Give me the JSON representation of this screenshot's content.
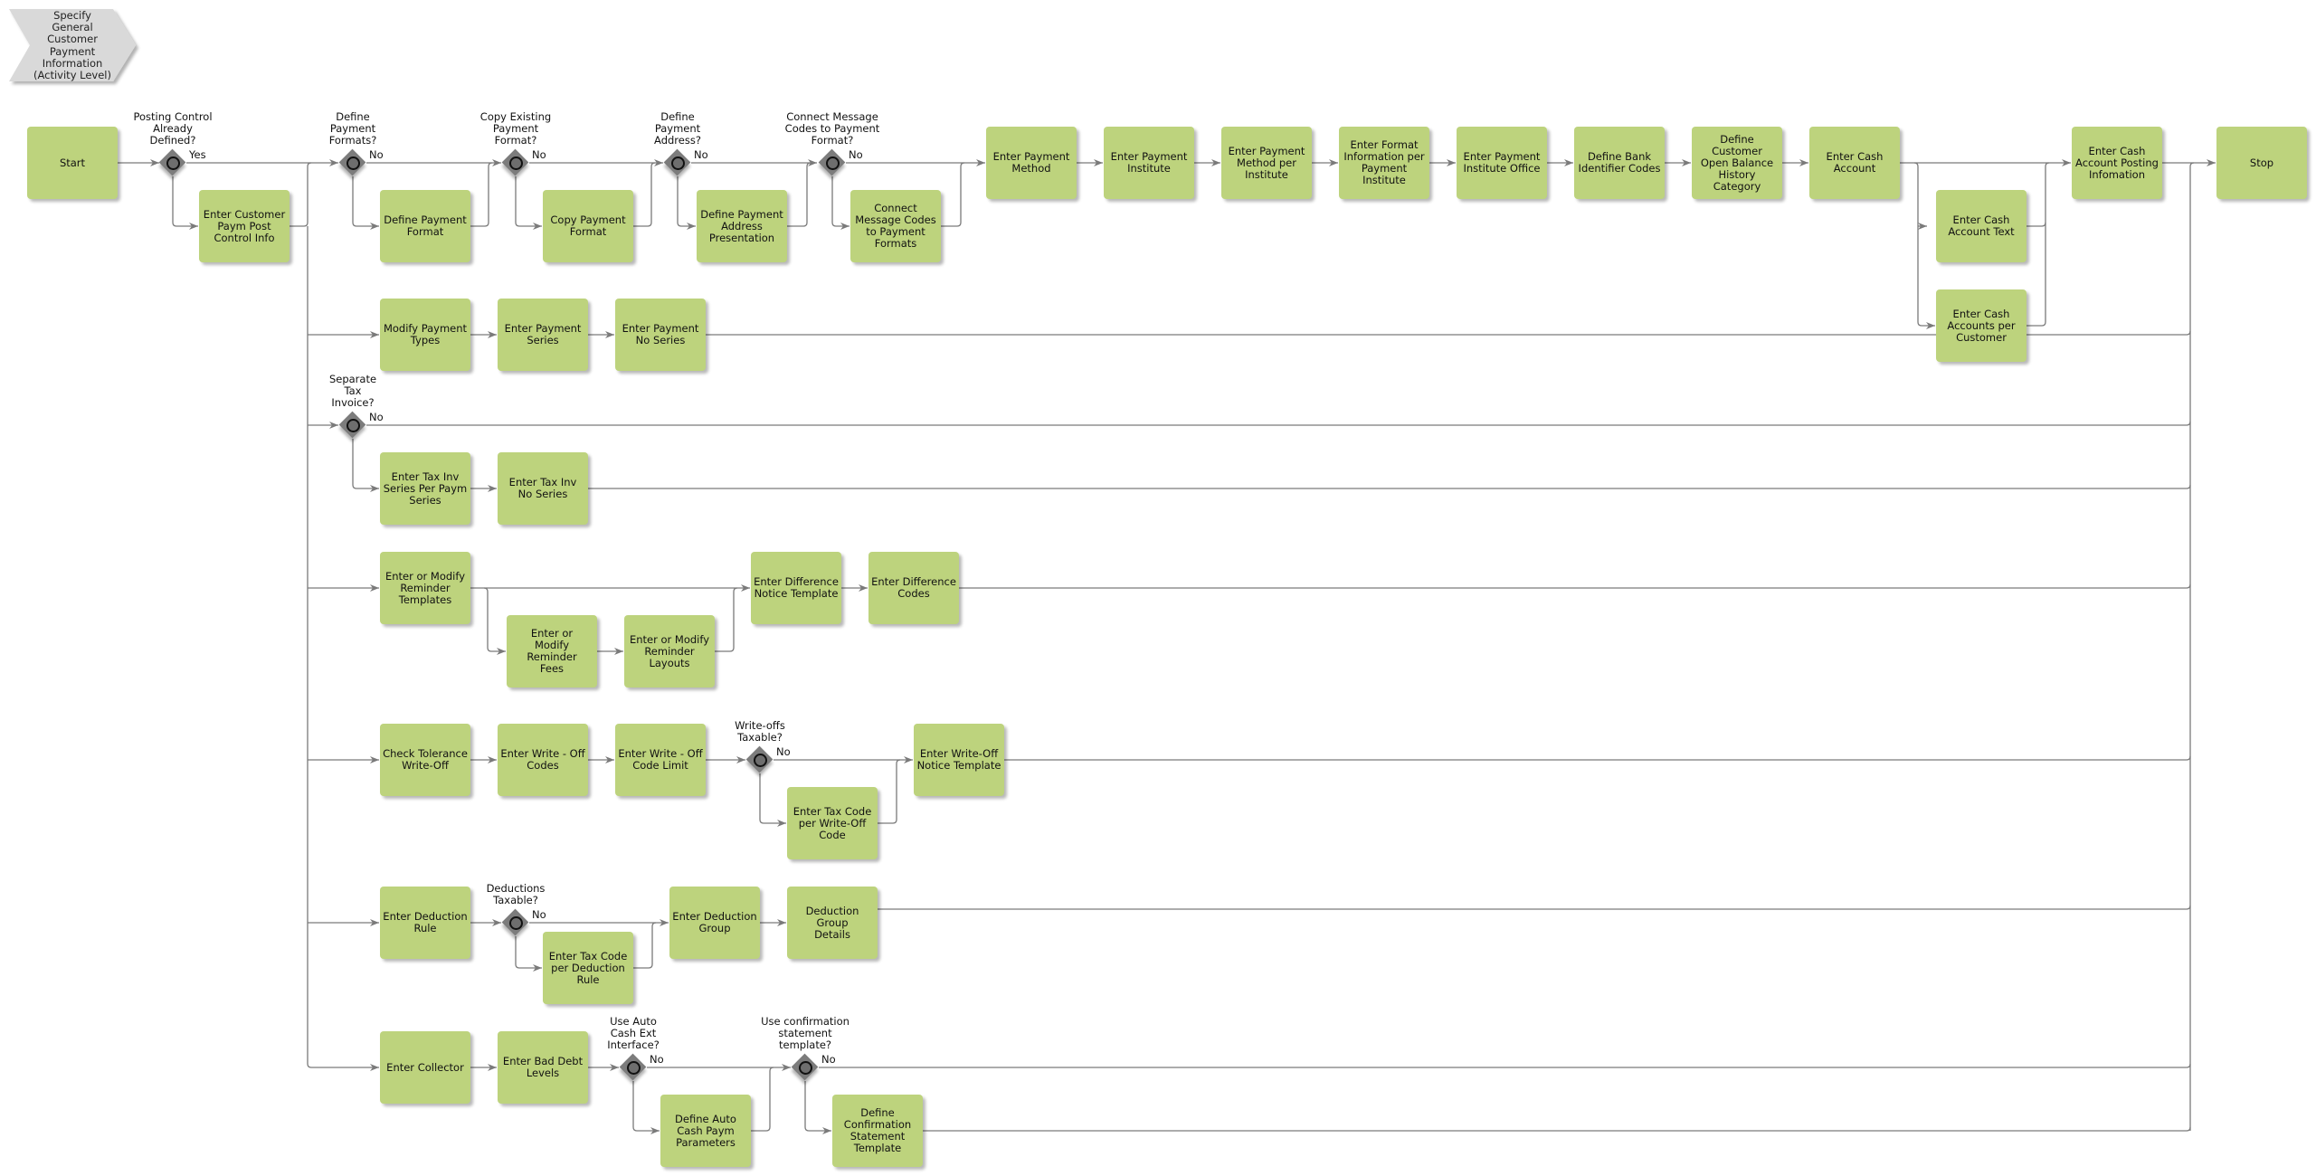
{
  "activity": {
    "title": "Specify General Customer Payment Information (Activity Level)",
    "lines": [
      "Specify",
      "General",
      "Customer",
      "Payment",
      "Information",
      "(Activity Level)"
    ]
  },
  "colors": {
    "task": "#bdd37d",
    "gateway": "#7c7c7c",
    "activity": "#d9d9d9",
    "wire": "#7a7a7a"
  },
  "tasks": [
    {
      "id": "start",
      "lines": [
        "Start"
      ]
    },
    {
      "id": "enter-customer-paym-post",
      "lines": [
        "Enter Customer",
        "Paym Post",
        "Control Info"
      ]
    },
    {
      "id": "define-payment-format",
      "lines": [
        "Define Payment",
        "Format"
      ]
    },
    {
      "id": "copy-payment-format",
      "lines": [
        "Copy Payment",
        "Format"
      ]
    },
    {
      "id": "define-payment-address",
      "lines": [
        "Define Payment",
        "Address",
        "Presentation"
      ]
    },
    {
      "id": "connect-message-codes",
      "lines": [
        "Connect",
        "Message Codes",
        "to Payment",
        "Formats"
      ]
    },
    {
      "id": "enter-payment-method",
      "lines": [
        "Enter Payment",
        "Method"
      ]
    },
    {
      "id": "enter-payment-institute",
      "lines": [
        "Enter Payment",
        "Institute"
      ]
    },
    {
      "id": "enter-payment-method-per-institute",
      "lines": [
        "Enter Payment",
        "Method per",
        "Institute"
      ]
    },
    {
      "id": "enter-format-info",
      "lines": [
        "Enter Format",
        "Information per",
        "Payment",
        "Institute"
      ]
    },
    {
      "id": "enter-payment-institute-office",
      "lines": [
        "Enter Payment",
        "Institute Office"
      ]
    },
    {
      "id": "define-bank-identifier",
      "lines": [
        "Define Bank",
        "Identifier Codes"
      ]
    },
    {
      "id": "define-customer-open-balance",
      "lines": [
        "Define",
        "Customer",
        "Open Balance",
        "History",
        "Category"
      ]
    },
    {
      "id": "enter-cash-account",
      "lines": [
        "Enter Cash",
        "Account"
      ]
    },
    {
      "id": "enter-cash-account-text",
      "lines": [
        "Enter Cash",
        "Account Text"
      ]
    },
    {
      "id": "enter-cash-accounts-per-customer",
      "lines": [
        "Enter Cash",
        "Accounts per",
        "Customer"
      ]
    },
    {
      "id": "enter-cash-account-posting",
      "lines": [
        "Enter Cash",
        "Account Posting",
        "Infomation"
      ]
    },
    {
      "id": "stop",
      "lines": [
        "Stop"
      ]
    },
    {
      "id": "modify-payment-types",
      "lines": [
        "Modify Payment",
        "Types"
      ]
    },
    {
      "id": "enter-payment-series",
      "lines": [
        "Enter Payment",
        "Series"
      ]
    },
    {
      "id": "enter-payment-no-series",
      "lines": [
        "Enter Payment",
        "No Series"
      ]
    },
    {
      "id": "enter-tax-inv-series",
      "lines": [
        "Enter Tax Inv",
        "Series Per Paym",
        "Series"
      ]
    },
    {
      "id": "enter-tax-inv-no-series",
      "lines": [
        "Enter Tax Inv",
        "No Series"
      ]
    },
    {
      "id": "enter-modify-reminder-templates",
      "lines": [
        "Enter or Modify",
        "Reminder",
        "Templates"
      ]
    },
    {
      "id": "enter-modify-reminder-fees",
      "lines": [
        "Enter or",
        "Modify",
        "Reminder",
        "Fees"
      ]
    },
    {
      "id": "enter-modify-reminder-layouts",
      "lines": [
        "Enter or Modify",
        "Reminder",
        "Layouts"
      ]
    },
    {
      "id": "enter-difference-notice-template",
      "lines": [
        "Enter Difference",
        "Notice Template"
      ]
    },
    {
      "id": "enter-difference-codes",
      "lines": [
        "Enter Difference",
        "Codes"
      ]
    },
    {
      "id": "check-tolerance-write-off",
      "lines": [
        "Check Tolerance",
        "Write-Off"
      ]
    },
    {
      "id": "enter-write-off-codes",
      "lines": [
        "Enter Write - Off",
        "Codes"
      ]
    },
    {
      "id": "enter-write-off-code-limit",
      "lines": [
        "Enter Write - Off",
        "Code Limit"
      ]
    },
    {
      "id": "enter-tax-code-write-off",
      "lines": [
        "Enter Tax Code",
        "per Write-Off",
        "Code"
      ]
    },
    {
      "id": "enter-write-off-notice-template",
      "lines": [
        "Enter Write-Off",
        "Notice Template"
      ]
    },
    {
      "id": "enter-deduction-rule",
      "lines": [
        "Enter Deduction",
        "Rule"
      ]
    },
    {
      "id": "enter-tax-code-deduction",
      "lines": [
        "Enter Tax Code",
        "per Deduction",
        "Rule"
      ]
    },
    {
      "id": "enter-deduction-group",
      "lines": [
        "Enter Deduction",
        "Group"
      ]
    },
    {
      "id": "deduction-group-details",
      "lines": [
        "Deduction Group",
        "Details"
      ]
    },
    {
      "id": "enter-collector",
      "lines": [
        "Enter Collector"
      ]
    },
    {
      "id": "enter-bad-debt-levels",
      "lines": [
        "Enter Bad Debt",
        "Levels"
      ]
    },
    {
      "id": "define-auto-cash-paym",
      "lines": [
        "Define Auto",
        "Cash Paym",
        "Parameters"
      ]
    },
    {
      "id": "define-confirmation-statement",
      "lines": [
        "Define",
        "Confirmation",
        "Statement",
        "Template"
      ]
    }
  ],
  "gateways": [
    {
      "id": "posting-control",
      "question": [
        "Posting Control",
        "Already",
        "Defined?"
      ],
      "outcome": "Yes"
    },
    {
      "id": "define-payment-formats",
      "question": [
        "Define",
        "Payment",
        "Formats?"
      ],
      "outcome": "No"
    },
    {
      "id": "copy-existing-format",
      "question": [
        "Copy Existing",
        "Payment",
        "Format?"
      ],
      "outcome": "No"
    },
    {
      "id": "define-payment-address-q",
      "question": [
        "Define",
        "Payment",
        "Address?"
      ],
      "outcome": "No"
    },
    {
      "id": "connect-message-codes-q",
      "question": [
        "Connect Message",
        "Codes to Payment",
        "Format?"
      ],
      "outcome": "No"
    },
    {
      "id": "separate-tax-invoice",
      "question": [
        "Separate",
        "Tax",
        "Invoice?"
      ],
      "outcome": "No"
    },
    {
      "id": "write-offs-taxable",
      "question": [
        "Write-offs",
        "Taxable?"
      ],
      "outcome": "No"
    },
    {
      "id": "deductions-taxable",
      "question": [
        "Deductions",
        "Taxable?"
      ],
      "outcome": "No"
    },
    {
      "id": "use-auto-cash",
      "question": [
        "Use Auto",
        "Cash Ext",
        "Interface?"
      ],
      "outcome": "No"
    },
    {
      "id": "use-confirmation-template",
      "question": [
        "Use confirmation",
        "statement",
        "template?"
      ],
      "outcome": "No"
    }
  ]
}
